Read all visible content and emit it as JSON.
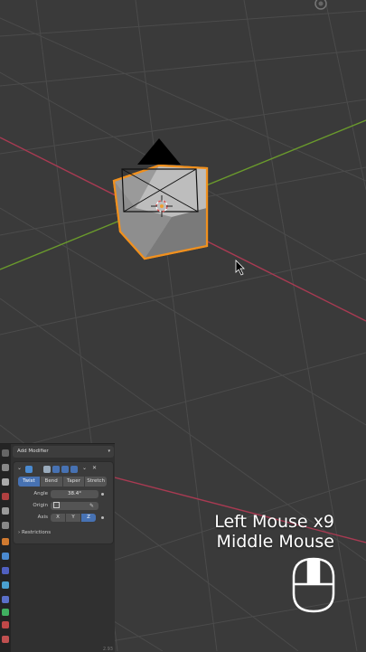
{
  "viewport": {
    "background": "#3a3a3a",
    "grid_color": "#484848",
    "x_axis_color": "#a83a52",
    "y_axis_color": "#6a9a2c",
    "selection_outline": "#f0901e"
  },
  "properties_panel": {
    "add_modifier_label": "Add Modifier",
    "modifier": {
      "mode_tabs": [
        "Twist",
        "Bend",
        "Taper",
        "Stretch"
      ],
      "active_mode": "Twist",
      "angle_label": "Angle",
      "angle_value": "38.4°",
      "origin_label": "Origin",
      "axis_label": "Axis",
      "axis_options": [
        "X",
        "Y",
        "Z"
      ],
      "active_axis": "Z",
      "restrictions_label": "Restrictions"
    },
    "footer_text": "2.93"
  },
  "key_overlay": {
    "line1": "Left Mouse x9",
    "line2": "Middle Mouse"
  },
  "colors": {
    "panel_bg": "#303030",
    "accent_blue": "#4772b3",
    "field_bg": "#545454"
  }
}
